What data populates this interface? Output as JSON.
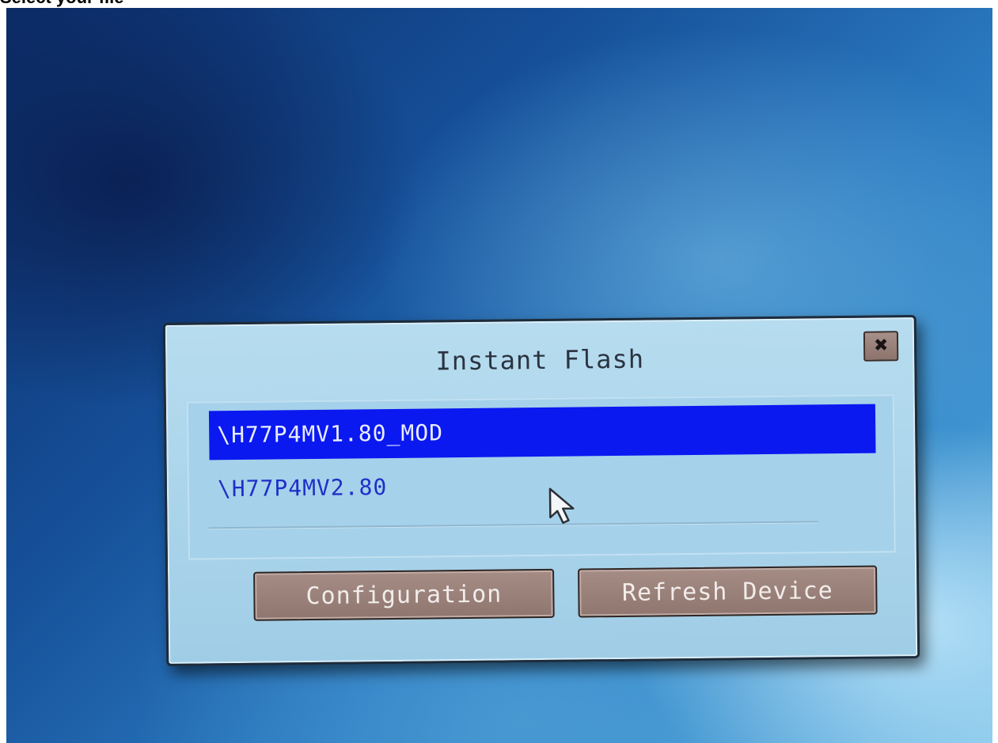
{
  "caption": {
    "text": "Select your file"
  },
  "dialog": {
    "title": "Instant Flash",
    "close_icon": "close-icon",
    "files": [
      {
        "label": "\\H77P4MV1.80_MOD",
        "selected": true
      },
      {
        "label": "\\H77P4MV2.80",
        "selected": false
      }
    ],
    "buttons": {
      "configuration": "Configuration",
      "refresh": "Refresh Device"
    }
  },
  "colors": {
    "selection": "#0a19f0",
    "item_text": "#1f2fc8",
    "dialog_bg": "#b7dcef",
    "button_bg": "#9a817a"
  },
  "cursor_icon": "arrow-pointer-icon"
}
